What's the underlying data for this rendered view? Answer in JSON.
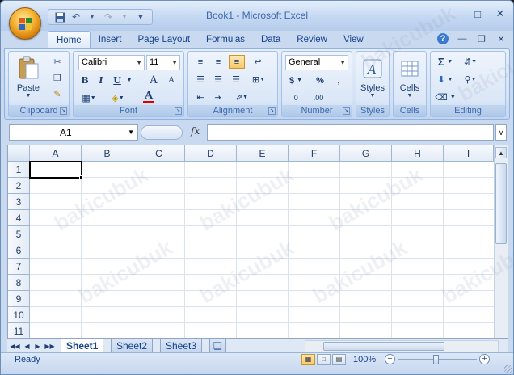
{
  "window": {
    "title": "Book1 - Microsoft Excel"
  },
  "quick_access": {
    "icons": [
      "save-icon",
      "undo-icon",
      "redo-icon",
      "customize-icon"
    ]
  },
  "tabs": [
    {
      "label": "Home",
      "active": true
    },
    {
      "label": "Insert"
    },
    {
      "label": "Page Layout"
    },
    {
      "label": "Formulas"
    },
    {
      "label": "Data"
    },
    {
      "label": "Review"
    },
    {
      "label": "View"
    }
  ],
  "ribbon": {
    "clipboard": {
      "label": "Clipboard",
      "paste": "Paste"
    },
    "font": {
      "label": "Font",
      "family": "Calibri",
      "size": "11",
      "bold": "B",
      "italic": "I",
      "underline": "U",
      "grow": "A",
      "shrink": "A",
      "font_color_letter": "A"
    },
    "alignment": {
      "label": "Alignment"
    },
    "number": {
      "label": "Number",
      "format": "General",
      "currency": "$",
      "percent": "%",
      "comma": ",",
      "inc_dec": ".0",
      "dec_dec": ".00"
    },
    "styles": {
      "label": "Styles",
      "button": "Styles"
    },
    "cells": {
      "label": "Cells",
      "button": "Cells"
    },
    "editing": {
      "label": "Editing",
      "sum": "Σ"
    }
  },
  "formula_bar": {
    "name_box": "A1",
    "fx": "fx",
    "formula": ""
  },
  "grid": {
    "columns": [
      "A",
      "B",
      "C",
      "D",
      "E",
      "F",
      "G",
      "H",
      "I"
    ],
    "rows": [
      "1",
      "2",
      "3",
      "4",
      "5",
      "6",
      "7",
      "8",
      "9",
      "10",
      "11"
    ],
    "selected_cell": "A1"
  },
  "sheet_tabs": [
    {
      "label": "Sheet1",
      "active": true
    },
    {
      "label": "Sheet2"
    },
    {
      "label": "Sheet3"
    }
  ],
  "status": {
    "text": "Ready",
    "zoom": "100%"
  },
  "watermark": "bakicubuk"
}
